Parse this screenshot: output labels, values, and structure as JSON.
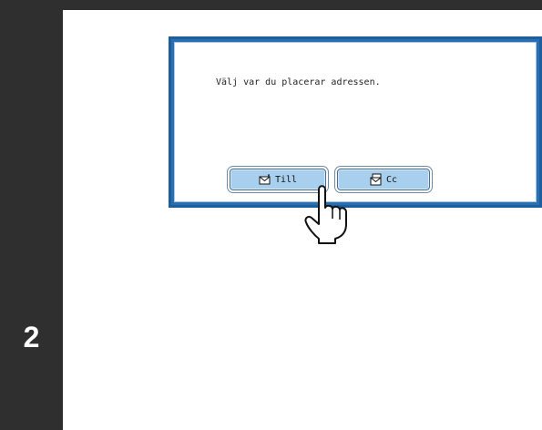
{
  "step": {
    "number": "2"
  },
  "dialog": {
    "message": "Välj var du placerar adressen.",
    "buttons": {
      "to_label": "Till",
      "to_icon": "mail-to-icon",
      "cc_label": "Cc",
      "cc_icon": "mail-cc-icon"
    }
  },
  "pointer": {
    "icon": "pointing-hand-icon"
  },
  "colors": {
    "sidebar": "#2f2f2f",
    "dialog_border": "#2a6fb0",
    "button_fill": "#a8d0ee"
  }
}
